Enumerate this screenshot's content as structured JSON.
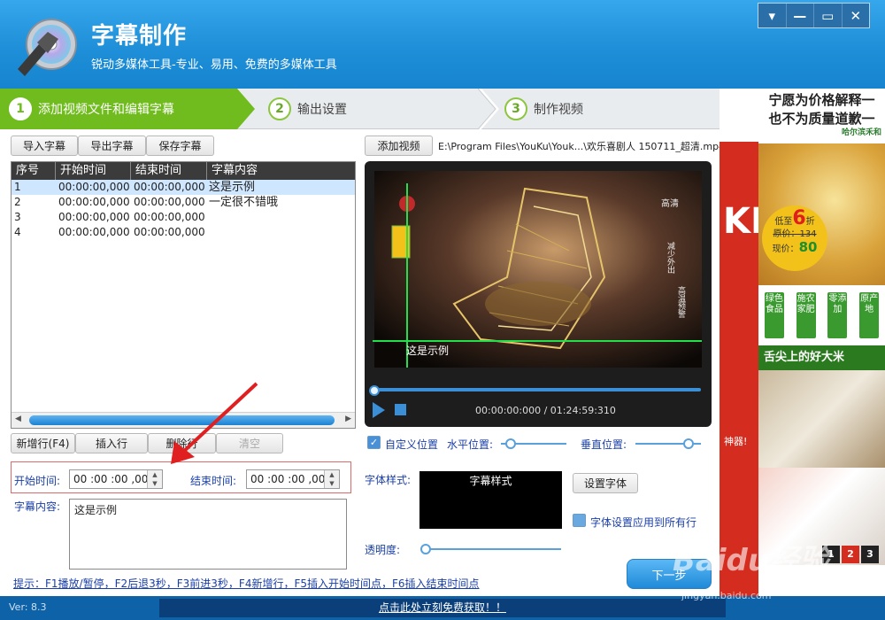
{
  "header": {
    "title": "字幕制作",
    "subtitle": "锐动多媒体工具-专业、易用、免费的多媒体工具",
    "window_buttons": [
      "▾",
      "—",
      "▭",
      "✕"
    ]
  },
  "steps": [
    {
      "num": "1",
      "label": "添加视频文件和编辑字幕",
      "active": true
    },
    {
      "num": "2",
      "label": "输出设置",
      "active": false
    },
    {
      "num": "3",
      "label": "制作视频",
      "active": false
    }
  ],
  "subtitle_toolbar": {
    "import": "导入字幕",
    "export": "导出字幕",
    "save": "保存字幕"
  },
  "subtitle_table": {
    "headers": [
      "序号",
      "开始时间",
      "结束时间",
      "字幕内容"
    ],
    "rows": [
      {
        "index": "1",
        "start": "00:00:00,000",
        "end": "00:00:00,000",
        "text": "这是示例"
      },
      {
        "index": "2",
        "start": "00:00:00,000",
        "end": "00:00:00,000",
        "text": "一定很不错哦"
      },
      {
        "index": "3",
        "start": "00:00:00,000",
        "end": "00:00:00,000",
        "text": ""
      },
      {
        "index": "4",
        "start": "00:00:00,000",
        "end": "00:00:00,000",
        "text": ""
      }
    ]
  },
  "row_buttons": {
    "add_row": "新增行(F4)",
    "insert_row": "插入行",
    "delete_row": "删除行",
    "clear": "清空"
  },
  "edit": {
    "start_label": "开始时间:",
    "start_value": "00 :00 :00 ,000",
    "end_label": "结束时间:",
    "end_value": "00 :00 :00 ,000",
    "content_label": "字幕内容:",
    "content_value": "这是示例"
  },
  "video": {
    "add_button": "添加视频",
    "path": "E:\\Program Files\\YouKu\\Youk...\\欢乐喜剧人 150711_超清.mp4",
    "overlay_subtitle": "这是示例",
    "time": "00:00:00:000 / 01:24:59:310",
    "progress": 0.0
  },
  "position": {
    "custom_label": "自定义位置",
    "custom_checked": true,
    "horizontal_label": "水平位置:",
    "horizontal_value": 0.1,
    "vertical_label": "垂直位置:",
    "vertical_value": 0.82
  },
  "font": {
    "style_label": "字体样式:",
    "preview_text": "字幕样式",
    "set_font_button": "设置字体",
    "apply_all_label": "字体设置应用到所有行",
    "apply_all_checked": false,
    "opacity_label": "透明度:",
    "opacity_value": 0.0
  },
  "footer": {
    "next_button": "下一步",
    "hint": "提示：F1播放/暂停，F2后退3秒，F3前进3秒，F4新增行，F5插入开始时间点，F6插入结束时间点",
    "version": "Ver: 8.3",
    "promo": "点击此处立刻免费获取！！"
  },
  "ad": {
    "line1": "宁愿为价格解释一",
    "line2": "也不为质量道歉一",
    "brand": "哈尔滨禾和",
    "price_prefix": "低至",
    "discount": "6",
    "discount_suffix": "折",
    "orig_price": "原价：134",
    "now_label": "现价：",
    "now_price": "80",
    "tags": [
      "绿色食品",
      "施农家肥",
      "零添加",
      "原产地"
    ],
    "banner": "舌尖上的好大米",
    "page_numbers": [
      "1",
      "2",
      "3"
    ],
    "red_text": "神器!"
  },
  "watermark": {
    "text": "Baidu经验",
    "sub": "jingyan.baidu.com"
  }
}
